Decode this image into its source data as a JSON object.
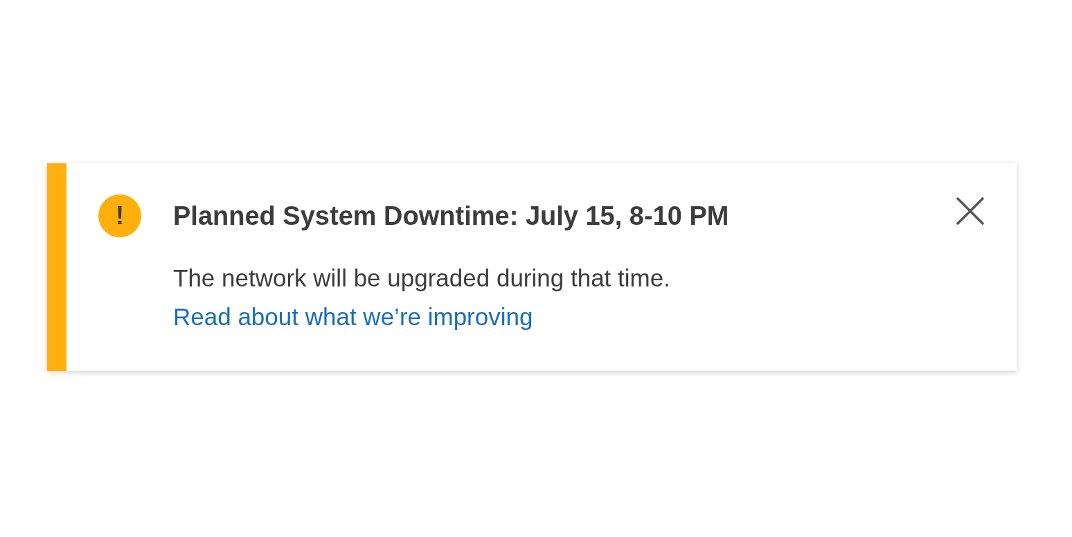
{
  "notice": {
    "kind": "warning",
    "icon": "!",
    "title": "Planned System Downtime: July 15, 8-10 PM",
    "message": "The network will be upgraded during that time.",
    "link": "Read about what we’re improving"
  }
}
